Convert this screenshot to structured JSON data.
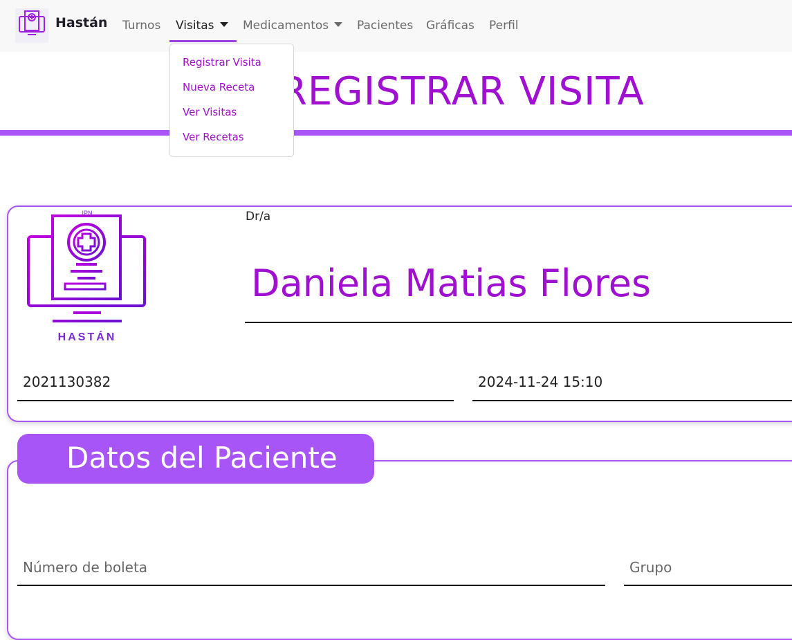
{
  "navbar": {
    "brand": "Hastán",
    "items": [
      {
        "label": "Turnos"
      },
      {
        "label": "Visitas"
      },
      {
        "label": "Medicamentos"
      },
      {
        "label": "Pacientes"
      },
      {
        "label": "Gráficas"
      },
      {
        "label": "Perfil"
      }
    ]
  },
  "dropdown": {
    "items": [
      "Registrar Visita",
      "Nueva Receta",
      "Ver Visitas",
      "Ver Recetas"
    ]
  },
  "page": {
    "title": "REGISTRAR VISITA"
  },
  "doctor_card": {
    "logo_top": "IPN",
    "logo_bottom": "HASTÁN",
    "prefix": "Dr/a",
    "name": "Daniela Matias Flores",
    "id_value": "2021130382",
    "datetime_value": "2024-11-24 15:10"
  },
  "patient_section": {
    "title": "Datos del Paciente",
    "boleta_placeholder": "Número de boleta",
    "grupo_placeholder": "Grupo"
  },
  "colors": {
    "accent": "#a855f7",
    "title": "#a010d0"
  }
}
